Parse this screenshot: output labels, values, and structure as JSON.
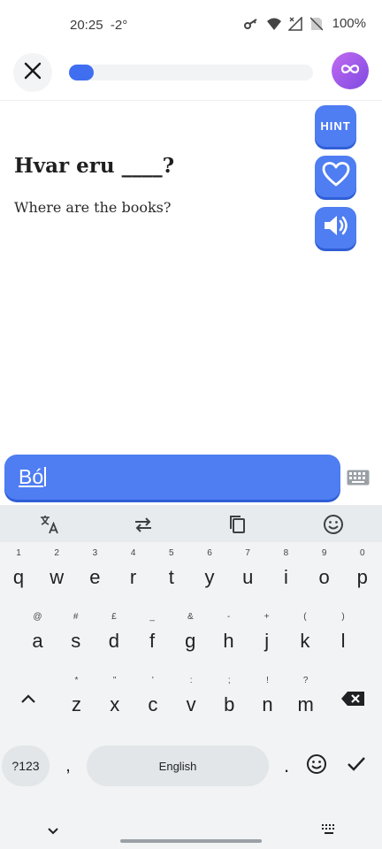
{
  "status_bar": {
    "time": "20:25",
    "temp": "-2°",
    "battery": "100%"
  },
  "header": {
    "progress_percent": 10
  },
  "side_buttons": {
    "hint_label": "HINT"
  },
  "question": {
    "prompt_start": "Hvar eru ",
    "blank": "____",
    "prompt_end": "?",
    "translation": "Where are the books?"
  },
  "answer": {
    "value": "Bó"
  },
  "keyboard": {
    "row1": [
      {
        "hint": "1",
        "label": "q"
      },
      {
        "hint": "2",
        "label": "w"
      },
      {
        "hint": "3",
        "label": "e"
      },
      {
        "hint": "4",
        "label": "r"
      },
      {
        "hint": "5",
        "label": "t"
      },
      {
        "hint": "6",
        "label": "y"
      },
      {
        "hint": "7",
        "label": "u"
      },
      {
        "hint": "8",
        "label": "i"
      },
      {
        "hint": "9",
        "label": "o"
      },
      {
        "hint": "0",
        "label": "p"
      }
    ],
    "row2": [
      {
        "hint": "@",
        "label": "a"
      },
      {
        "hint": "#",
        "label": "s"
      },
      {
        "hint": "£",
        "label": "d"
      },
      {
        "hint": "_",
        "label": "f"
      },
      {
        "hint": "&",
        "label": "g"
      },
      {
        "hint": "-",
        "label": "h"
      },
      {
        "hint": "+",
        "label": "j"
      },
      {
        "hint": "(",
        "label": "k"
      },
      {
        "hint": ")",
        "label": "l"
      }
    ],
    "row3": [
      {
        "hint": "*",
        "label": "z"
      },
      {
        "hint": "\"",
        "label": "x"
      },
      {
        "hint": "'",
        "label": "c"
      },
      {
        "hint": ":",
        "label": "v"
      },
      {
        "hint": ";",
        "label": "b"
      },
      {
        "hint": "!",
        "label": "n"
      },
      {
        "hint": "?",
        "label": "m"
      }
    ],
    "symbols_label": "?123",
    "comma": ",",
    "space_label": "English",
    "period": "."
  },
  "colors": {
    "accent": "#4f7df2",
    "progress": "#3f6ef0",
    "infinity_gradient": [
      "#c26af2",
      "#7d4ae0"
    ]
  },
  "icons": [
    "close-icon",
    "infinity-icon",
    "heart-icon",
    "speaker-icon",
    "keyboard-icon",
    "translate-icon",
    "swap-icon",
    "clipboard-icon",
    "emoji-icon",
    "shift-icon",
    "backspace-icon",
    "enter-icon",
    "chevron-down-icon",
    "keyboard-grid-icon"
  ]
}
